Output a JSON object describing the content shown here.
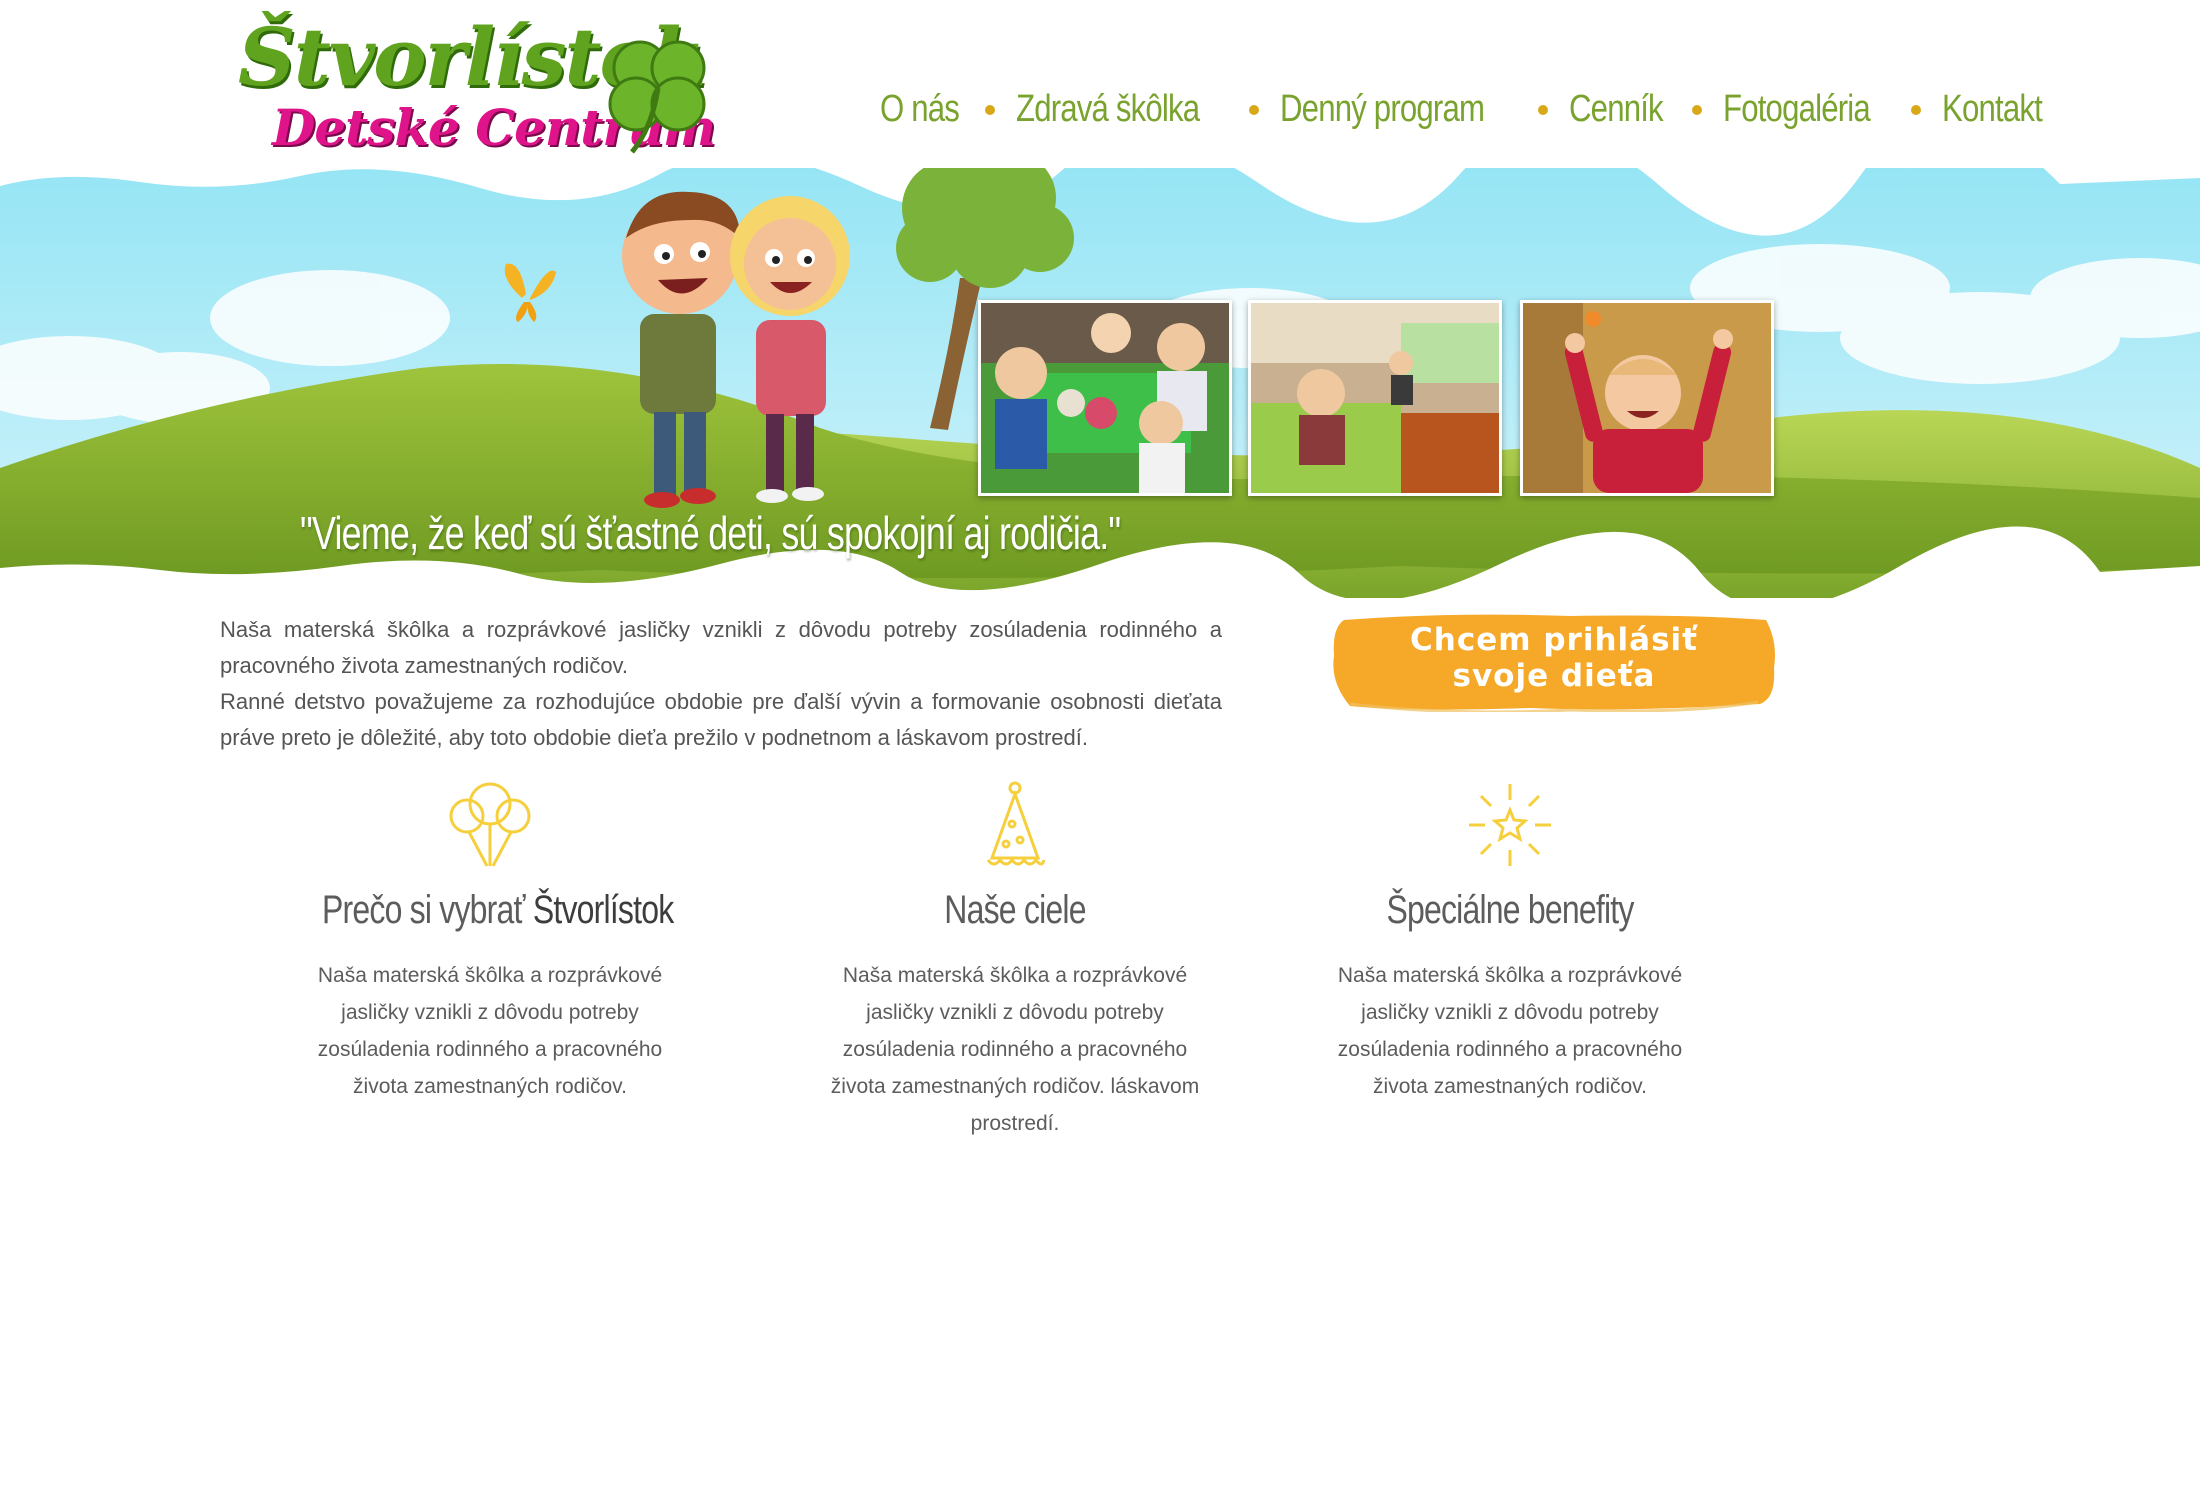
{
  "brand": {
    "name": "Štvorlístok",
    "subtitle": "Detské Centrum"
  },
  "nav": {
    "items": [
      "O nás",
      "Zdravá škôlka",
      "Denný program",
      "Cenník",
      "Fotogaléria",
      "Kontakt"
    ]
  },
  "hero": {
    "quote": "\"Vieme, že keď sú šťastné deti, sú spokojní aj rodičia.\""
  },
  "intro": {
    "line1": "Naša materská škôlka a rozprávkové jasličky vznikli z dôvodu potreby zosúladenia rodinného a pracovného života zamestnaných rodičov.",
    "line2": "Ranné detstvo považujeme za rozhodujúce obdobie pre ďalší vývin a formovanie osobnosti dieťata práve preto je dôležité, aby toto obdobie dieťa prežilo v podnetnom a láskavom prostredí."
  },
  "cta": {
    "line1": "Chcem prihlásiť",
    "line2": "svoje dieťa"
  },
  "features": [
    {
      "icon": "balloons-icon",
      "title_prefix": "Prečo si vybrať ",
      "title_accent": "Štvorlístok",
      "text": "Naša materská škôlka a rozprávkové jasličky vznikli z dôvodu potreby zosúladenia rodinného a pracovného života zamestnaných rodičov."
    },
    {
      "icon": "party-hat-icon",
      "title_prefix": "Naše ciele",
      "title_accent": "",
      "text": "Naša materská škôlka a rozprávkové jasličky vznikli z dôvodu potreby zosúladenia rodinného a pracovného života zamestnaných rodičov. láskavom prostredí."
    },
    {
      "icon": "star-burst-icon",
      "title_prefix": "Špeciálne benefity",
      "title_accent": "",
      "text": "Naša materská škôlka a rozprávkové jasličky vznikli z dôvodu potreby zosúladenia rodinného a pracovného života zamestnaných rodičov."
    }
  ],
  "colors": {
    "brand_green": "#5fa31e",
    "brand_pink": "#e0148a",
    "nav_green": "#79a32e",
    "cta_orange": "#f6a928",
    "icon_yellow": "#f5cf3c"
  }
}
